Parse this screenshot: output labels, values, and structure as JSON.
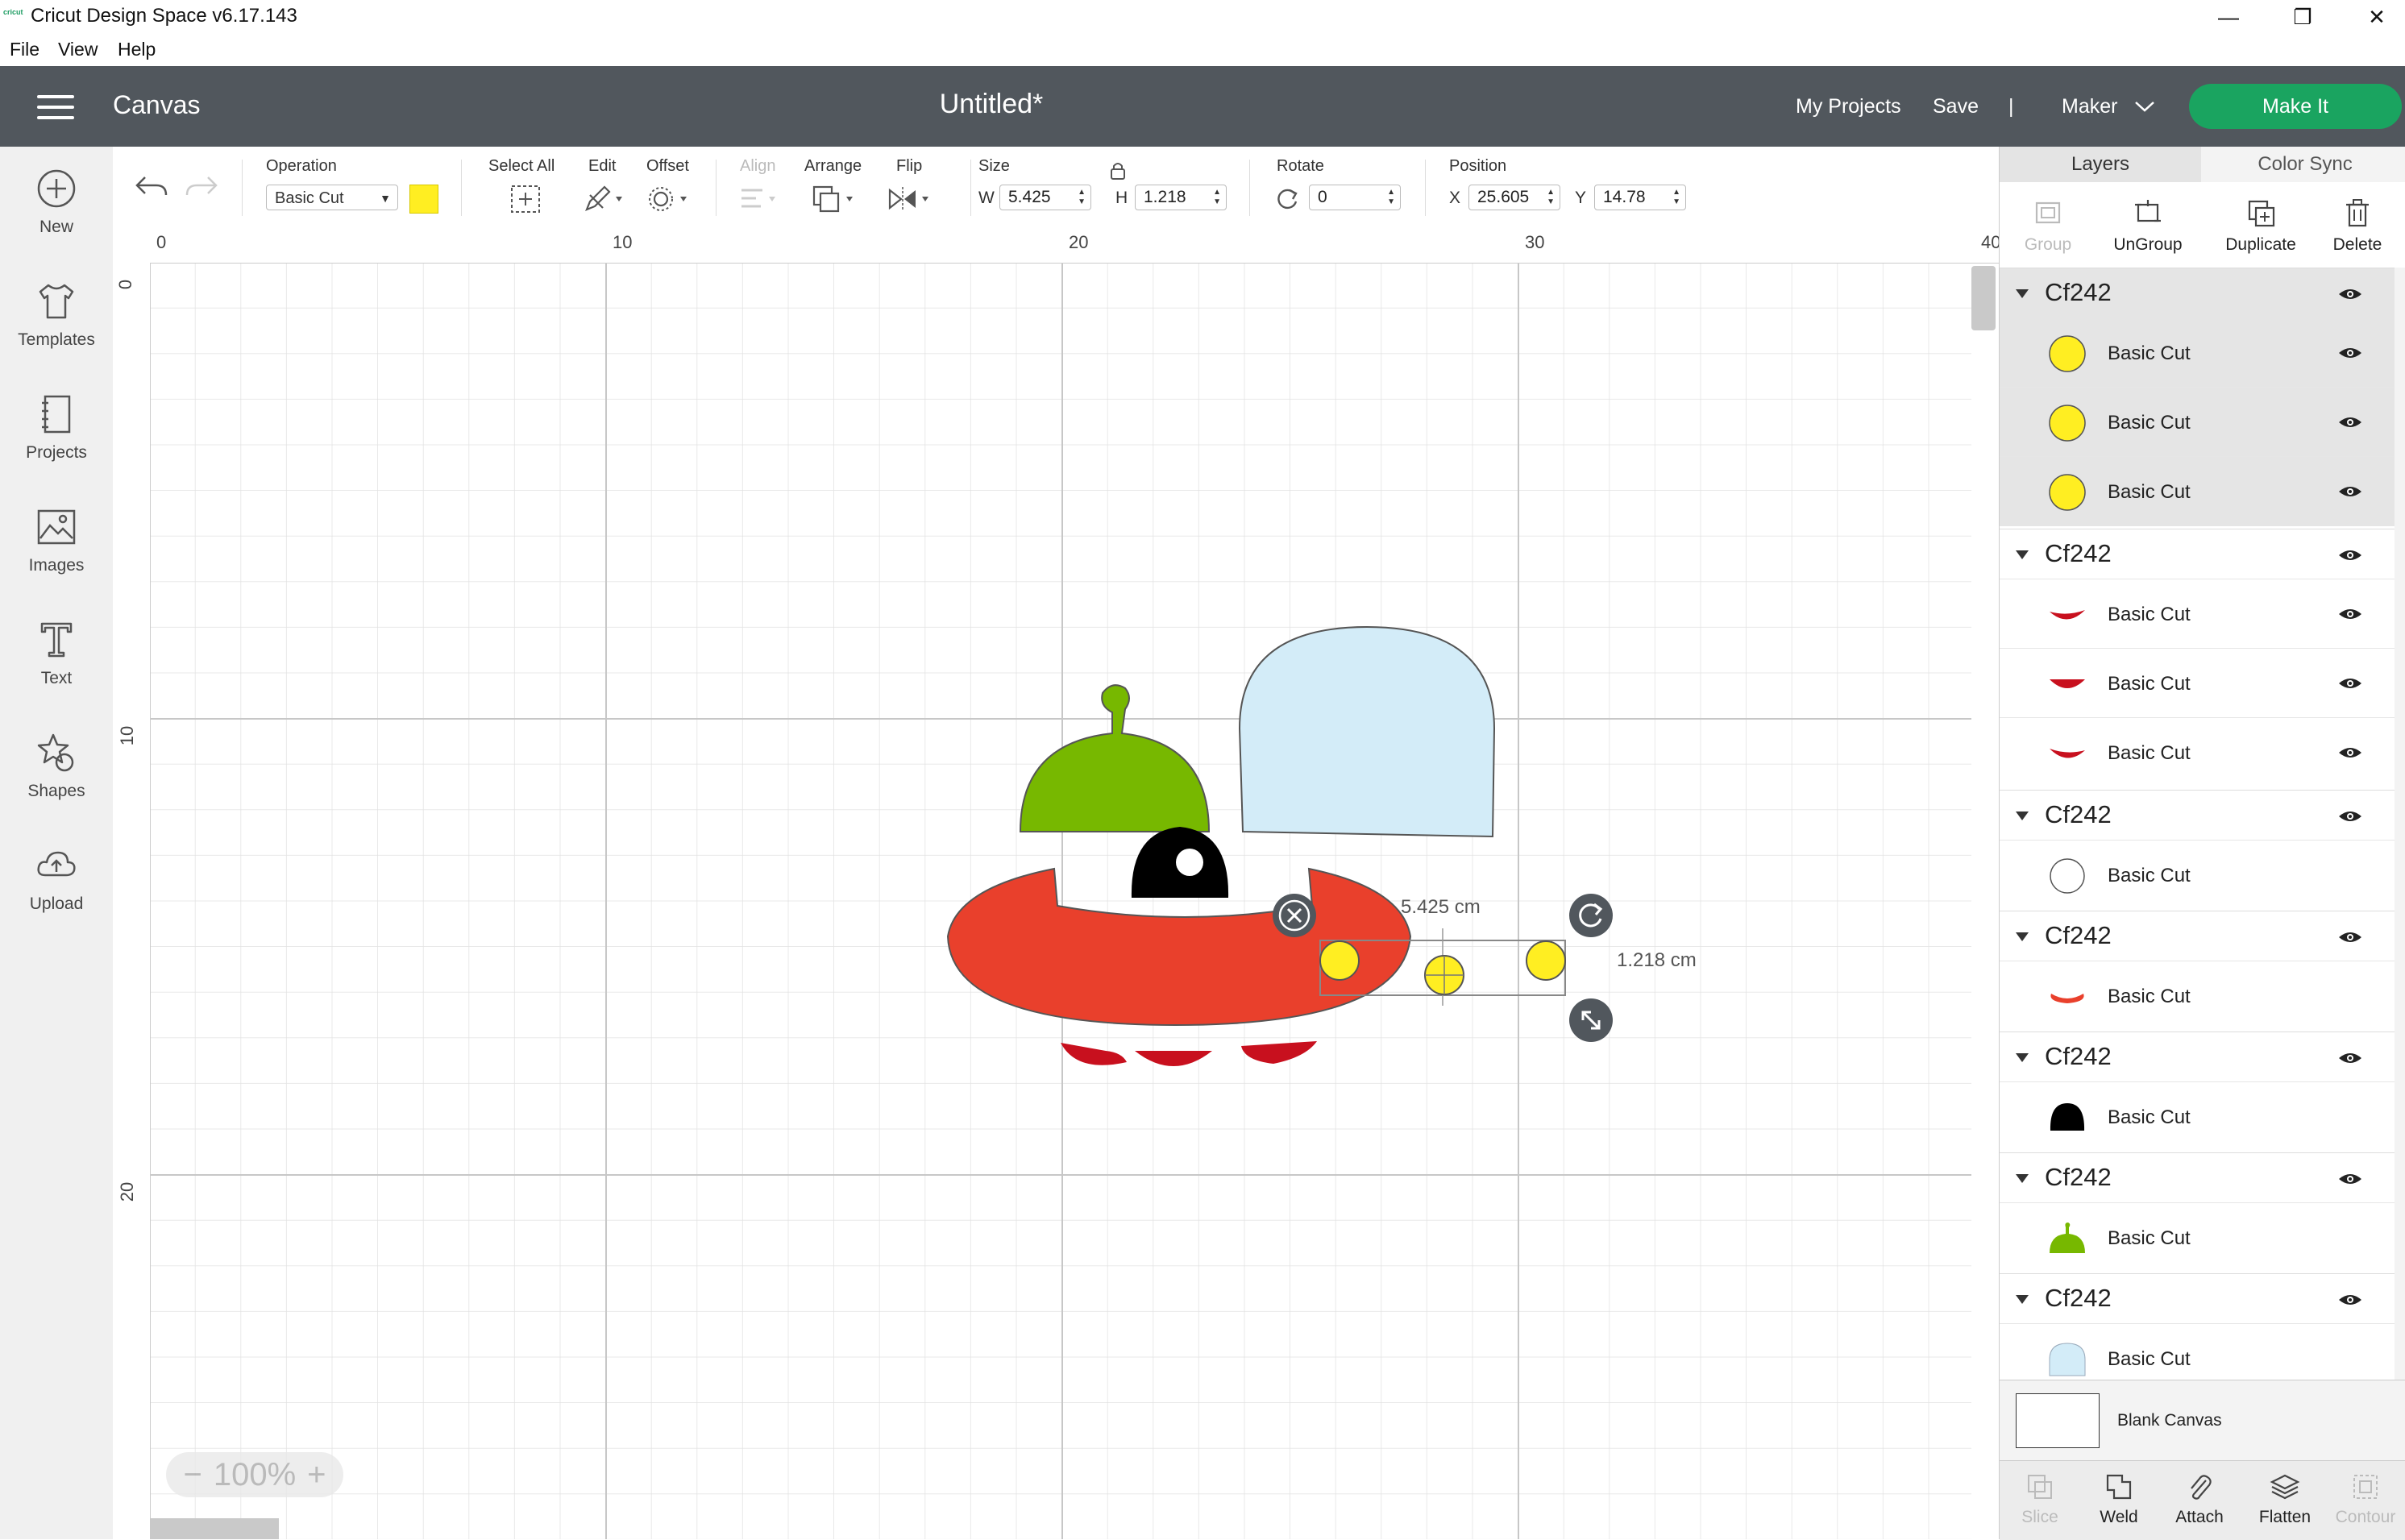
{
  "window": {
    "logo_text": "cricut",
    "title": "Cricut Design Space  v6.17.143",
    "minimize_glyph": "—",
    "restore_glyph": "❐",
    "close_glyph": "✕"
  },
  "menubar": {
    "items": [
      "File",
      "View",
      "Help"
    ]
  },
  "header": {
    "section": "Canvas",
    "doc_title": "Untitled*",
    "my_projects": "My Projects",
    "save": "Save",
    "separator": "|",
    "machine": "Maker",
    "make_it": "Make It",
    "brand_green": "#1aa460"
  },
  "sidebar": {
    "items": [
      {
        "label": "New",
        "icon": "plus-circle-icon"
      },
      {
        "label": "Templates",
        "icon": "tshirt-icon"
      },
      {
        "label": "Projects",
        "icon": "notebook-icon"
      },
      {
        "label": "Images",
        "icon": "image-icon"
      },
      {
        "label": "Text",
        "icon": "text-T-icon"
      },
      {
        "label": "Shapes",
        "icon": "shapes-icon"
      },
      {
        "label": "Upload",
        "icon": "cloud-upload-icon"
      }
    ]
  },
  "toolbar": {
    "operation_label": "Operation",
    "operation_value": "Basic Cut",
    "operation_color": "#ffee22",
    "select_all": "Select All",
    "edit": "Edit",
    "offset": "Offset",
    "align": "Align",
    "arrange": "Arrange",
    "flip": "Flip",
    "size": "Size",
    "w_label": "W",
    "w_value": "5.425",
    "h_label": "H",
    "h_value": "1.218",
    "rotate": "Rotate",
    "rotate_value": "0",
    "position": "Position",
    "x_label": "X",
    "x_value": "25.605",
    "y_label": "Y",
    "y_value": "14.78"
  },
  "canvas": {
    "ruler_top": [
      "0",
      "10",
      "20",
      "30",
      "40"
    ],
    "ruler_left": [
      "0",
      "10",
      "20"
    ],
    "width_label": "5.425 cm",
    "height_label": "1.218 cm",
    "zoom_value": "100%",
    "zoom_minus": "−",
    "zoom_plus": "+",
    "colors": {
      "saucer": "#e9402c",
      "dome_green": "#77b800",
      "dome_glass": "#d3ecf8",
      "legs": "#c8101e",
      "lights": "#ffee22",
      "eye": "#000000"
    }
  },
  "panel": {
    "tabs": [
      "Layers",
      "Color Sync"
    ],
    "actions": [
      "Group",
      "UnGroup",
      "Duplicate",
      "Delete"
    ],
    "groups": [
      {
        "name": "Cf242",
        "layers": [
          {
            "label": "Basic Cut",
            "thumb": "yellow-circle",
            "color": "#ffee22"
          },
          {
            "label": "Basic Cut",
            "thumb": "yellow-circle",
            "color": "#ffee22"
          },
          {
            "label": "Basic Cut",
            "thumb": "yellow-circle",
            "color": "#ffee22"
          }
        ]
      },
      {
        "name": "Cf242",
        "layers": [
          {
            "label": "Basic Cut",
            "thumb": "red-leg",
            "color": "#c8101e"
          },
          {
            "label": "Basic Cut",
            "thumb": "red-leg",
            "color": "#c8101e"
          },
          {
            "label": "Basic Cut",
            "thumb": "red-leg",
            "color": "#c8101e"
          }
        ]
      },
      {
        "name": "Cf242",
        "layers": [
          {
            "label": "Basic Cut",
            "thumb": "white-circle",
            "color": "#ffffff"
          }
        ]
      },
      {
        "name": "Cf242",
        "layers": [
          {
            "label": "Basic Cut",
            "thumb": "red-saucer",
            "color": "#e9402c"
          }
        ]
      },
      {
        "name": "Cf242",
        "layers": [
          {
            "label": "Basic Cut",
            "thumb": "black-eye",
            "color": "#000000"
          }
        ]
      },
      {
        "name": "Cf242",
        "layers": [
          {
            "label": "Basic Cut",
            "thumb": "green-dome",
            "color": "#77b800"
          }
        ]
      },
      {
        "name": "Cf242",
        "layers": [
          {
            "label": "Basic Cut",
            "thumb": "blue-dome",
            "color": "#d3ecf8"
          }
        ]
      }
    ],
    "blank_canvas": "Blank Canvas",
    "bottom_actions": [
      "Slice",
      "Weld",
      "Attach",
      "Flatten",
      "Contour"
    ]
  }
}
